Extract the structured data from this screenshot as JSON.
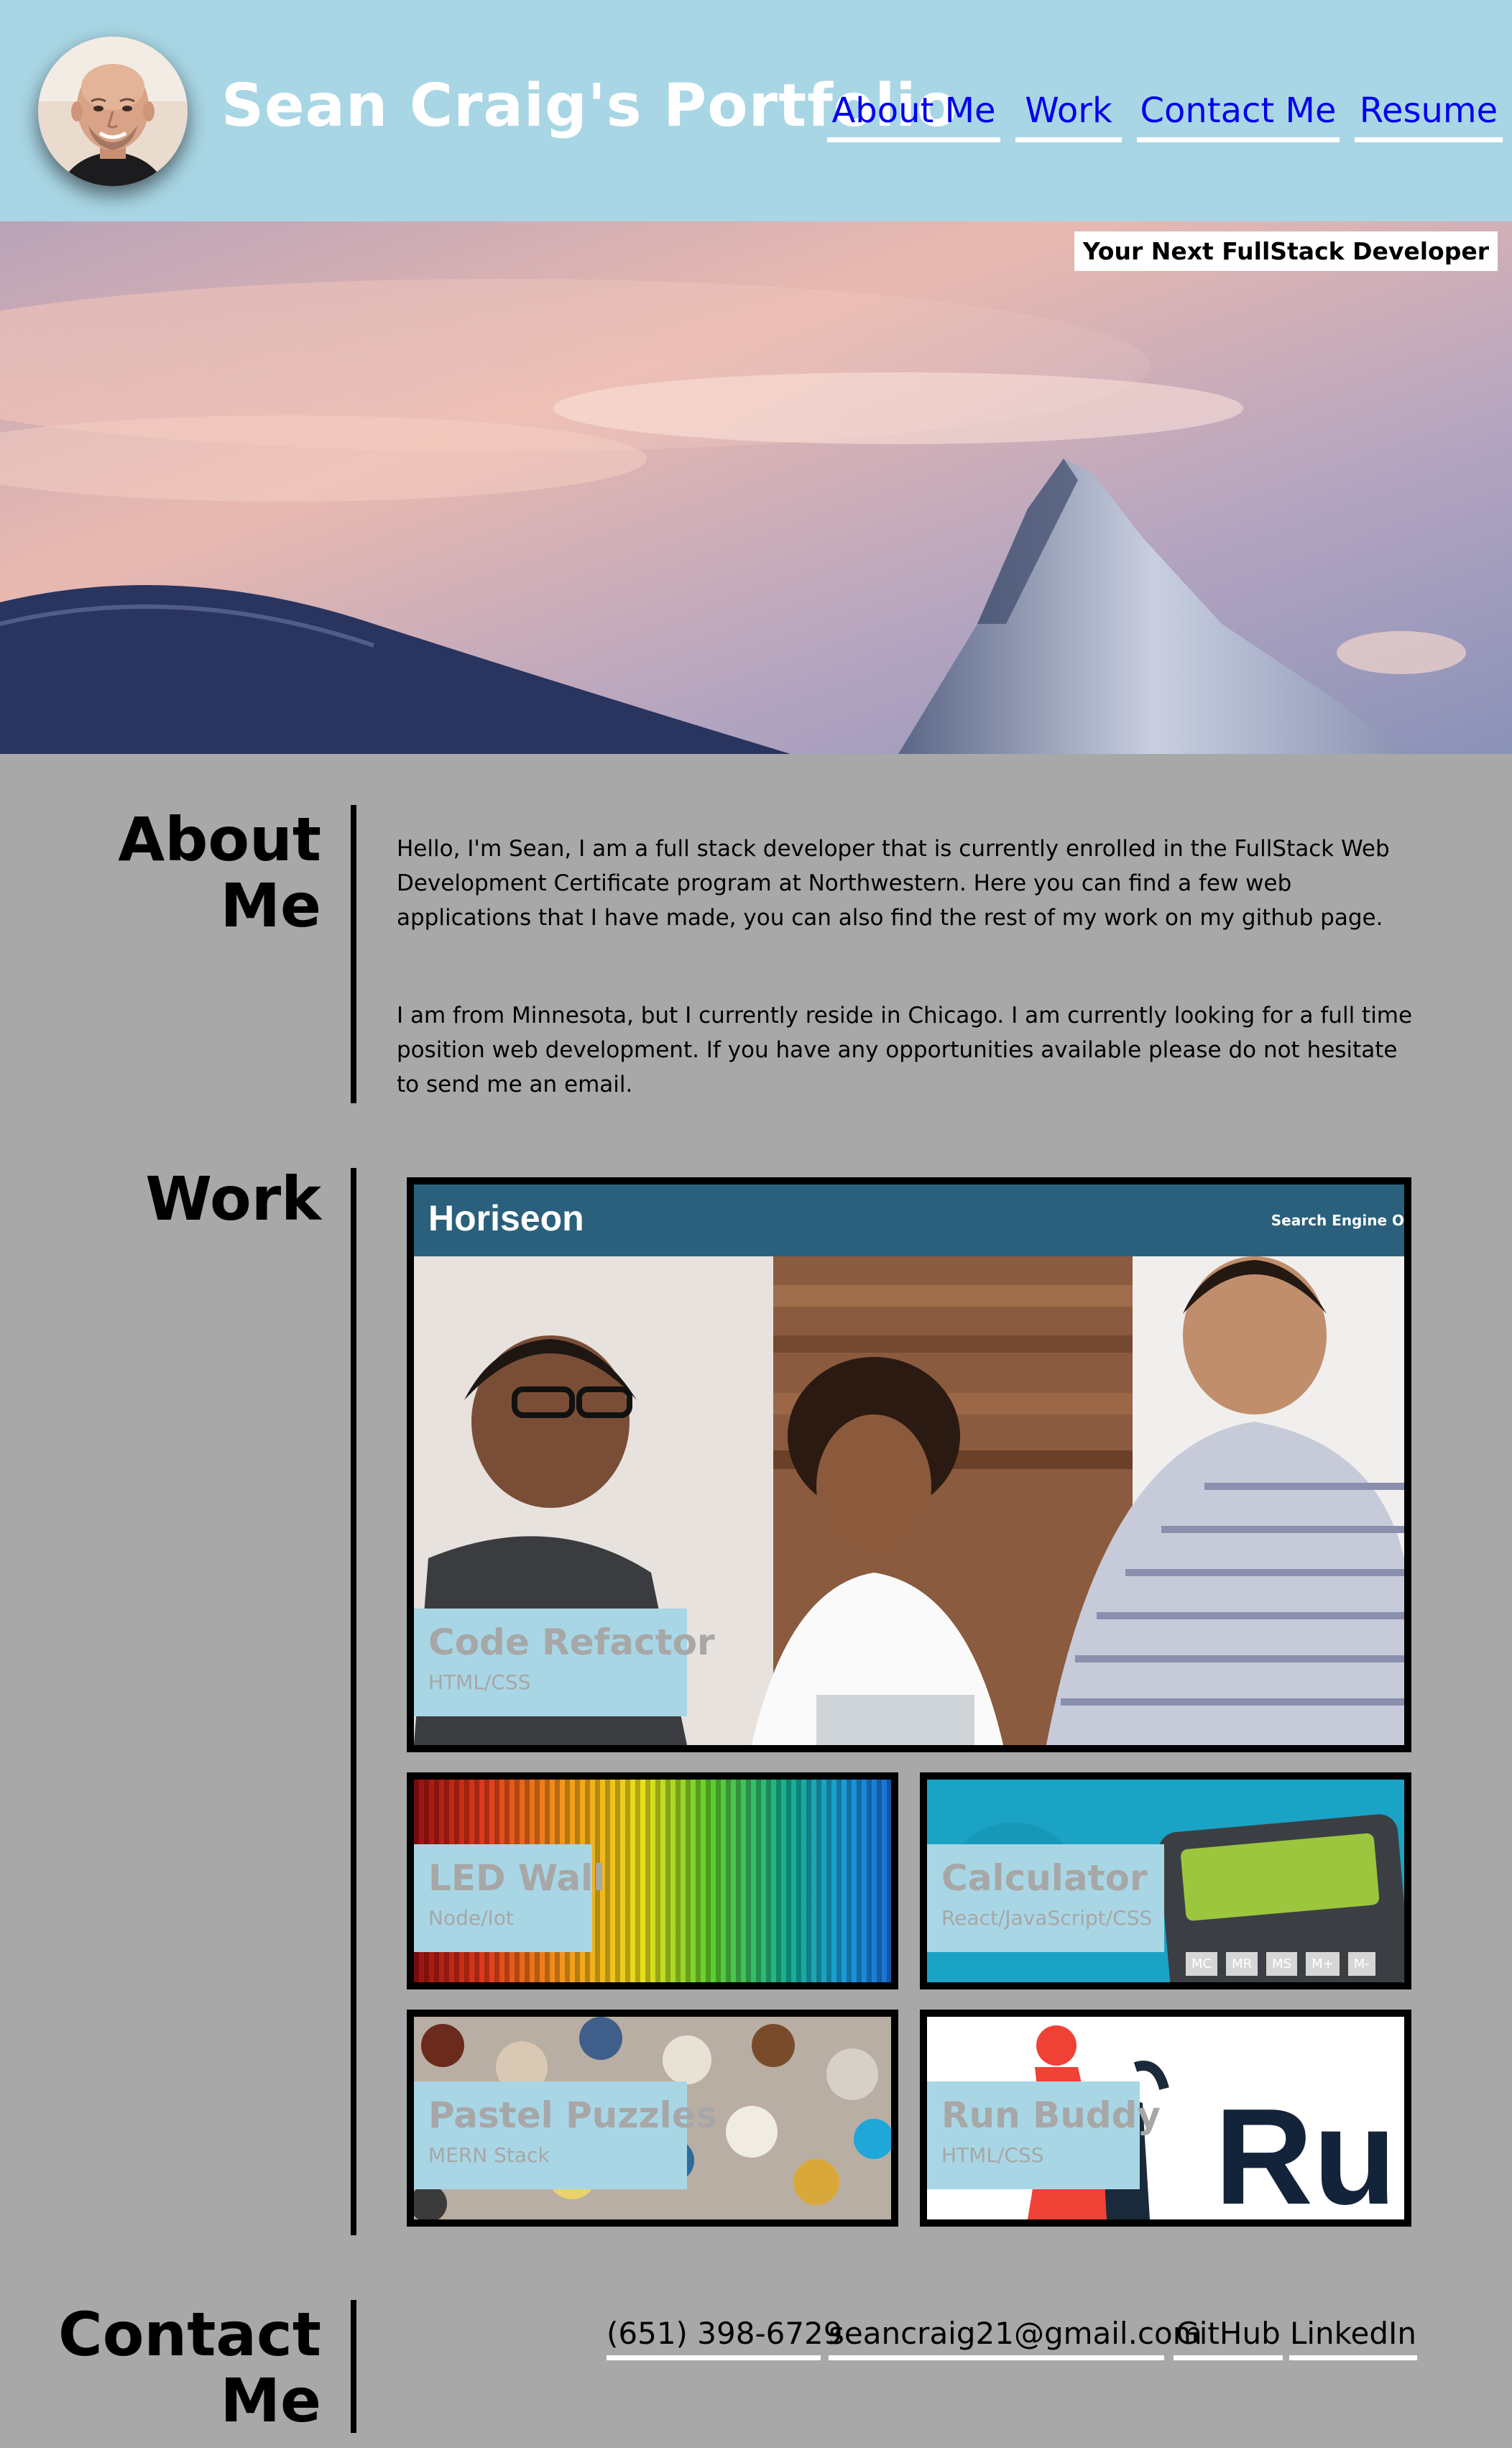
{
  "header": {
    "title": "Sean Craig's Portfolio",
    "nav": [
      {
        "label": "About Me"
      },
      {
        "label": "Work"
      },
      {
        "label": "Contact Me"
      },
      {
        "label": "Resume"
      }
    ]
  },
  "hero": {
    "tagline": "Your Next FullStack Developer"
  },
  "about": {
    "heading_line1": "About",
    "heading_line2": "Me",
    "paragraph1": "Hello, I'm Sean, I am a full stack developer that is currently enrolled in the FullStack Web Development Certificate program at Northwestern. Here you can find a few web applications that I have made, you can also find the rest of my work on my github page.",
    "paragraph2": "I am from Minnesota, but I currently reside in Chicago. I am currently looking for a full time position web development. If you have any opportunities available please do not hesitate to send me an email."
  },
  "work": {
    "heading": "Work",
    "featured": {
      "title": "Code Refactor",
      "tech": "HTML/CSS",
      "screenshot_brand": "Horiseon",
      "screenshot_nav": "Search Engine O"
    },
    "projects": [
      {
        "title": "LED Wall",
        "tech": "Node/Iot"
      },
      {
        "title": "Calculator",
        "tech": "React/JavaScript/CSS",
        "keys": [
          "MC",
          "MR",
          "MS",
          "M+",
          "M-"
        ]
      },
      {
        "title": "Pastel Puzzles",
        "tech": "MERN Stack"
      },
      {
        "title": "Run Buddy",
        "tech": "HTML/CSS",
        "logo_text": "Run"
      }
    ]
  },
  "contact": {
    "heading_line1": "Contact",
    "heading_line2": "Me",
    "links": [
      {
        "label": "(651) 398-6729"
      },
      {
        "label": "seancraig21@gmail.com"
      },
      {
        "label": "GitHub"
      },
      {
        "label": "LinkedIn"
      }
    ]
  },
  "colors": {
    "header_bg": "#a9d6e5",
    "page_bg": "#a8a8a8",
    "nav_link": "#0000ee",
    "card_label_text": "#a7a7a7"
  }
}
